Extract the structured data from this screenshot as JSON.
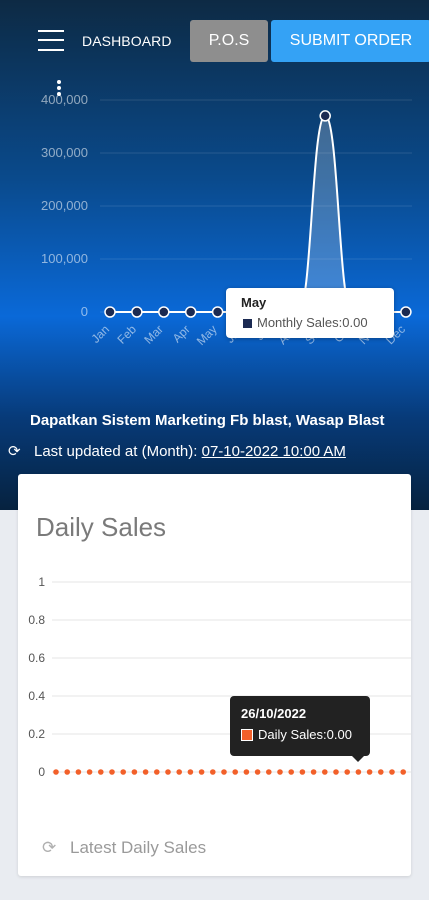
{
  "topbar": {
    "menu_icon": "hamburger-icon",
    "title": "DASHBOARD",
    "pos_label": "P.O.S",
    "submit_label": "SUBMIT ORDER"
  },
  "monthly": {
    "marquee": "Dapatkan Sistem Marketing Fb blast, Wasap Blast",
    "updated_label": "Last updated at (Month):",
    "updated_value": "07-10-2022 10:00 AM",
    "tooltip": {
      "title": "May",
      "text": "Monthly Sales:0.00"
    }
  },
  "daily": {
    "title": "Daily Sales",
    "footer": "Latest Daily Sales",
    "tooltip": {
      "title": "26/10/2022",
      "text": "Daily Sales:0.00"
    }
  },
  "colors": {
    "monthly_series": "#1b2a52",
    "daily_series": "#f2602a",
    "submit": "#34a2f5",
    "pos": "#8e8e8e"
  },
  "chart_data": [
    {
      "type": "area",
      "categories": [
        "Jan",
        "Feb",
        "Mar",
        "Apr",
        "May",
        "Jun",
        "Jul",
        "Aug",
        "Sep",
        "Oct",
        "Nov",
        "Dec"
      ],
      "series": [
        {
          "name": "Monthly Sales",
          "values": [
            0,
            0,
            0,
            0,
            0,
            0,
            0,
            0,
            370000,
            0,
            0,
            0
          ]
        }
      ],
      "yticks": [
        "0",
        "100,000",
        "200,000",
        "300,000",
        "400,000"
      ],
      "ylim": [
        0,
        400000
      ],
      "grid": true
    },
    {
      "type": "line",
      "x": [
        "1",
        "2",
        "3",
        "4",
        "5",
        "6",
        "7",
        "8",
        "9",
        "10",
        "11",
        "12",
        "13",
        "14",
        "15",
        "16",
        "17",
        "18",
        "19",
        "20",
        "21",
        "22",
        "23",
        "24",
        "25",
        "26",
        "27",
        "28",
        "29",
        "30",
        "31",
        "32"
      ],
      "series": [
        {
          "name": "Daily Sales",
          "values": [
            0,
            0,
            0,
            0,
            0,
            0,
            0,
            0,
            0,
            0,
            0,
            0,
            0,
            0,
            0,
            0,
            0,
            0,
            0,
            0,
            0,
            0,
            0,
            0,
            0,
            0,
            0,
            0,
            0,
            0,
            0,
            0
          ]
        }
      ],
      "yticks": [
        "0",
        "0.2",
        "0.4",
        "0.6",
        "0.8",
        "1"
      ],
      "ylim": [
        0,
        1
      ],
      "grid": true
    }
  ]
}
